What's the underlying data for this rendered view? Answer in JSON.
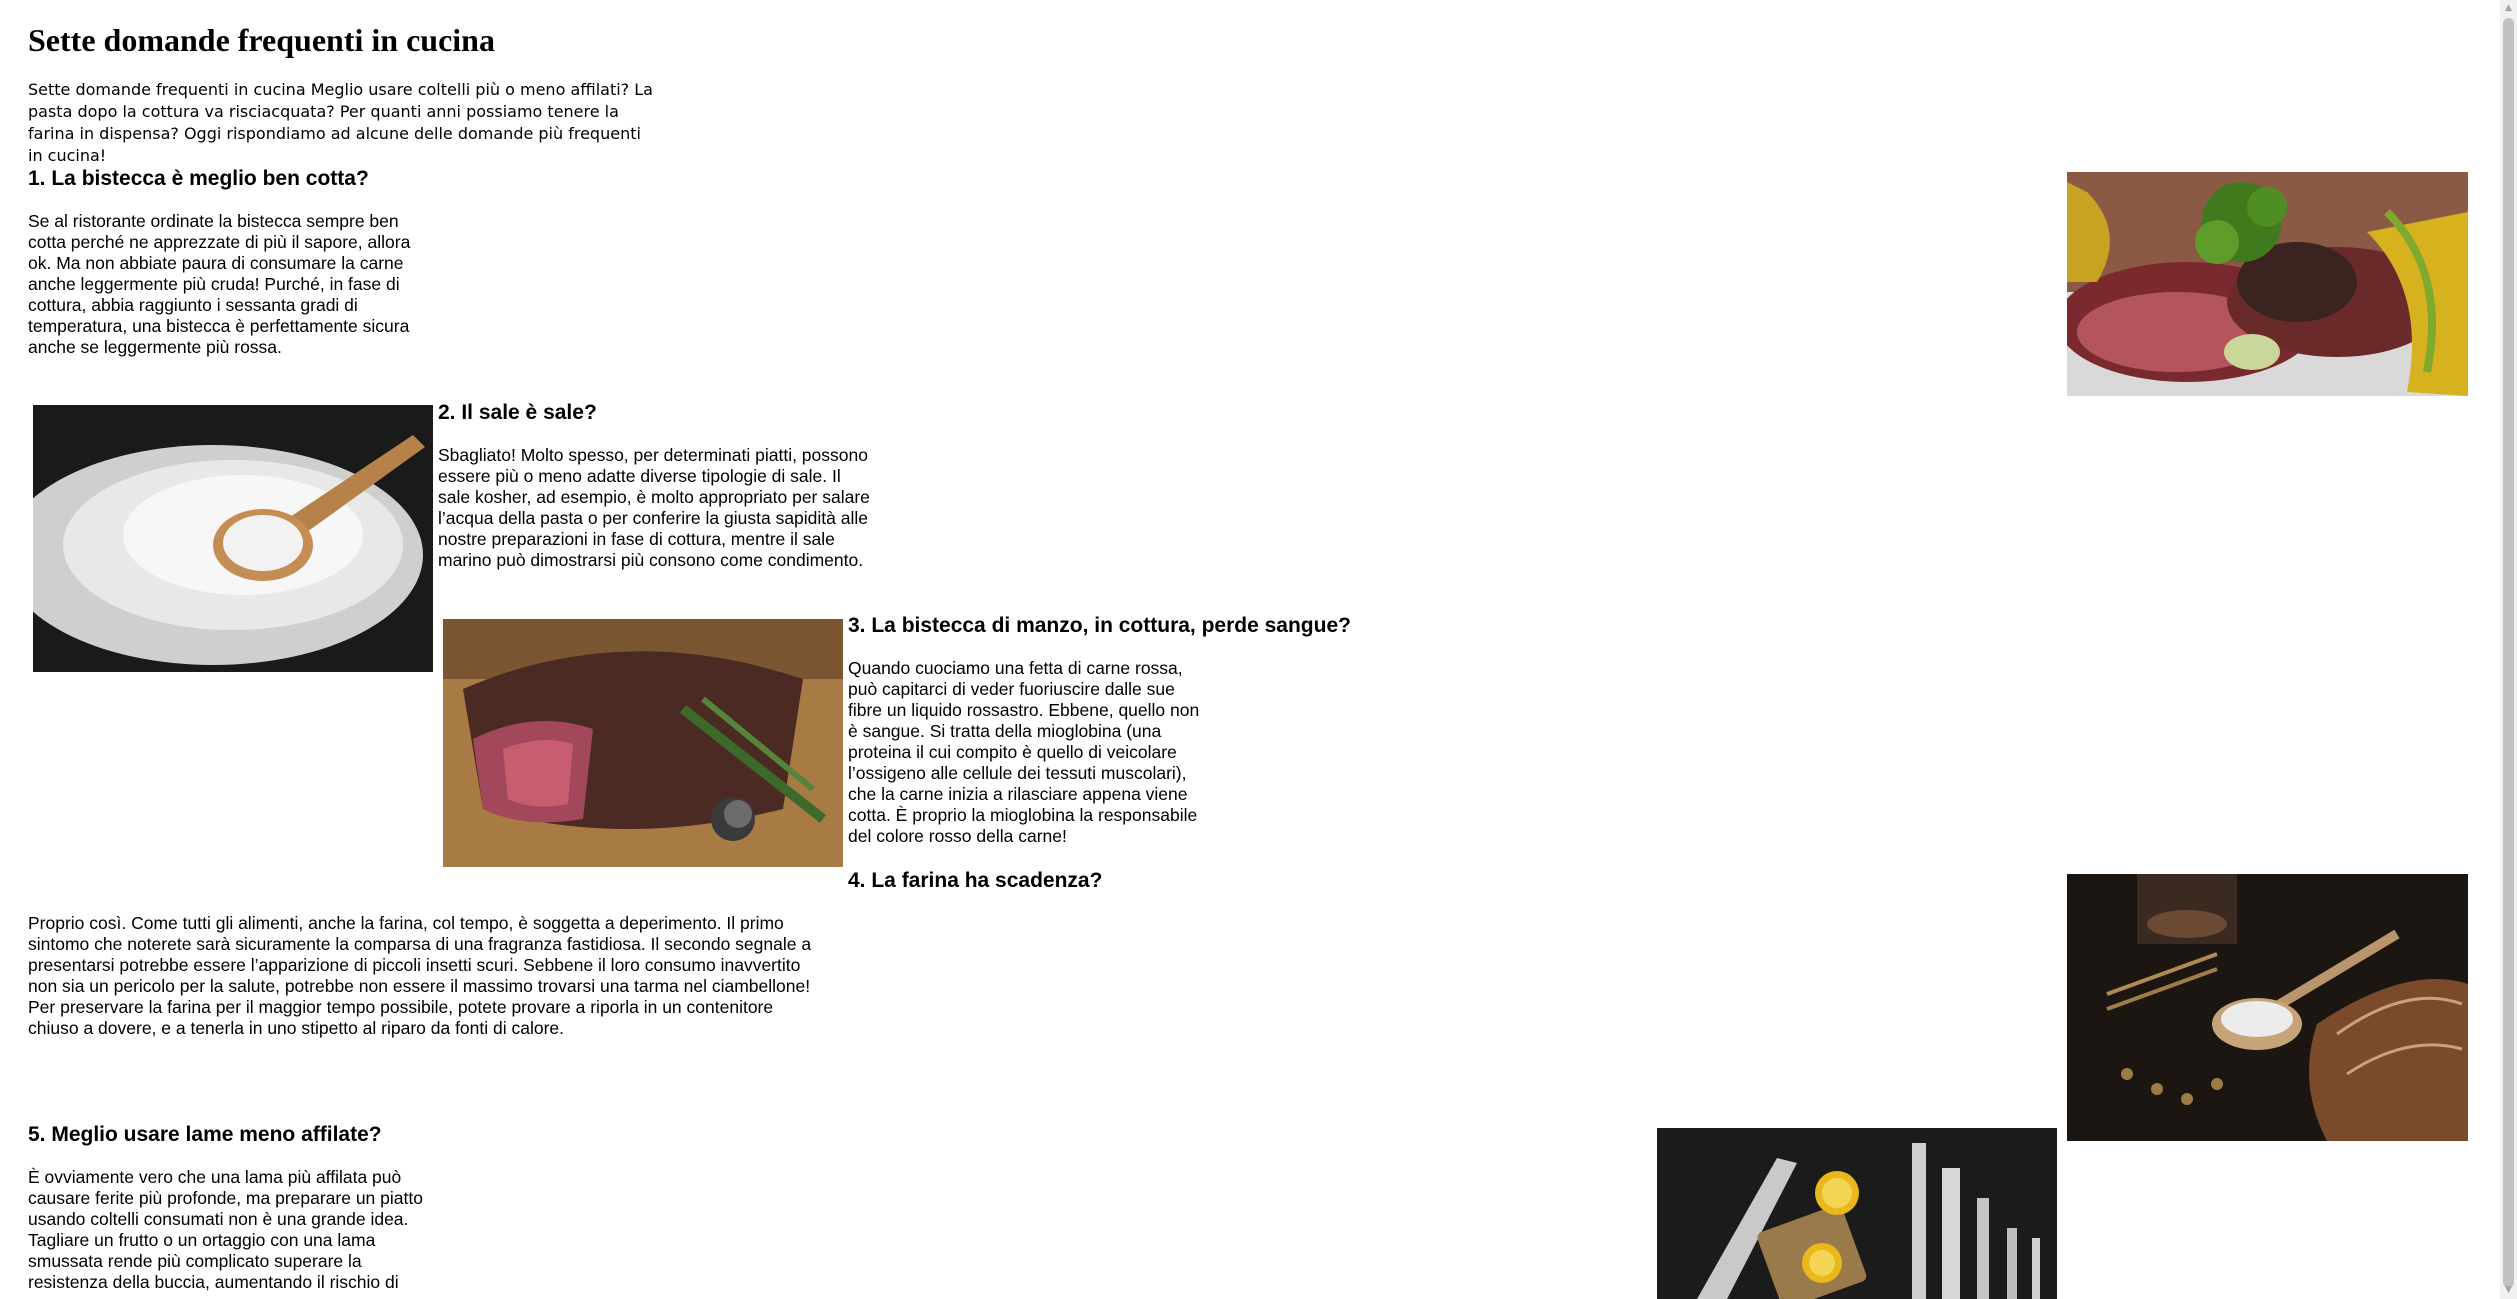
{
  "page": {
    "title": "Sette domande frequenti in cucina",
    "intro": "Sette domande frequenti in cucina Meglio usare coltelli più o meno affilati? La pasta dopo la cottura va risciacquata? Per quanti anni possiamo tenere la farina in dispensa? Oggi rispondiamo ad alcune delle domande più frequenti in cucina!"
  },
  "sections": [
    {
      "heading": "1. La bistecca è meglio ben cotta?",
      "text": "Se al ristorante ordinate la bistecca sempre ben cotta perché ne apprezzate di più il sapore, allora ok. Ma non abbiate paura di consumare la carne anche leggermente più cruda! Purché, in fase di cottura, abbia raggiunto i sessanta gradi di temperatura, una bistecca è perfettamente sicura anche se leggermente più rossa.",
      "image_icon": "steak-photo"
    },
    {
      "heading": "2. Il sale è sale?",
      "text": "Sbagliato! Molto spesso, per determinati piatti, possono essere più o meno adatte diverse tipologie di sale. Il sale kosher, ad esempio, è molto appropriato per salare l’acqua della pasta o per conferire la giusta sapidità alle nostre preparazioni in fase di cottura, mentre il sale marino può dimostrarsi più consono come condimento.",
      "image_icon": "salt-spoon-photo"
    },
    {
      "heading": "3. La bistecca di manzo, in cottura, perde sangue?",
      "text": "Quando cuociamo una fetta di carne rossa, può capitarci di veder fuoriuscire dalle sue fibre un liquido rossastro. Ebbene, quello non è sangue. Si tratta della mioglobina (una proteina il cui compito è quello di veicolare l’ossigeno alle cellule dei tessuti muscolari), che la carne inizia a rilasciare appena viene cotta. È proprio la mioglobina la responsabile del colore rosso della carne!",
      "image_icon": "beef-roast-photo"
    },
    {
      "heading": "4. La farina ha scadenza?",
      "text": "Proprio così. Come tutti gli alimenti, anche la farina, col tempo, è soggetta a deperimento. Il primo sintomo che noterete sarà sicuramente la comparsa di una fragranza fastidiosa. Il secondo segnale a presentarsi potrebbe essere l’apparizione di piccoli insetti scuri. Sebbene il loro consumo inavvertito non sia un pericolo per la salute, potrebbe non essere il massimo trovarsi una tarma nel ciambellone! Per preservare la farina per il maggior tempo possibile, potete provare a riporla in un contenitore chiuso a dovere, e a tenerla in uno stipetto al riparo da fonti di calore.",
      "image_icon": "flour-bread-photo"
    },
    {
      "heading": "5. Meglio usare lame meno affilate?",
      "text": "È ovviamente vero che una lama più affilata può causare ferite più profonde, ma preparare un piatto usando coltelli consumati non è una grande idea. Tagliare un frutto o un ortaggio con una lama smussata rende più complicato superare la resistenza della buccia, aumentando il rischio di",
      "image_icon": "knives-photo"
    }
  ]
}
